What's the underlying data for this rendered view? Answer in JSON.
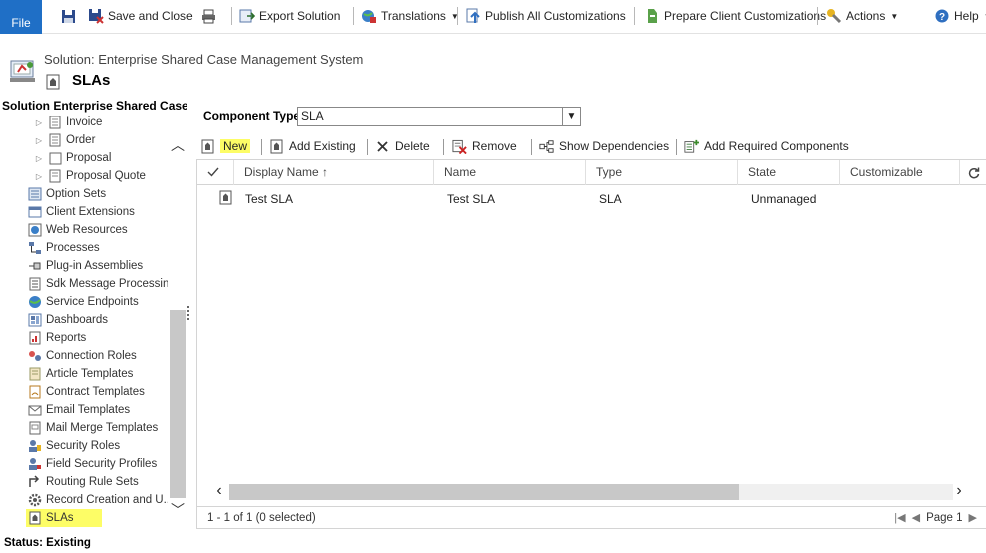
{
  "ribbon": {
    "file": "File",
    "save": "",
    "save_close": "Save and Close",
    "export": "Export Solution",
    "translations": "Translations",
    "publish": "Publish All Customizations",
    "prepare": "Prepare Client Customizations",
    "actions": "Actions",
    "help": "Help"
  },
  "header": {
    "solution": "Solution: Enterprise Shared Case Management System",
    "title": "SLAs"
  },
  "nav": {
    "title": "Solution Enterprise Shared Case...",
    "items": [
      {
        "label": "Invoice",
        "icon": "document-icon",
        "child": true
      },
      {
        "label": "Order",
        "icon": "order-icon",
        "child": true
      },
      {
        "label": "Proposal",
        "icon": "proposal-icon",
        "child": true
      },
      {
        "label": "Proposal Quote",
        "icon": "quote-icon",
        "child": true
      },
      {
        "label": "Option Sets",
        "icon": "option-sets-icon"
      },
      {
        "label": "Client Extensions",
        "icon": "client-extensions-icon"
      },
      {
        "label": "Web Resources",
        "icon": "web-resources-icon"
      },
      {
        "label": "Processes",
        "icon": "processes-icon"
      },
      {
        "label": "Plug-in Assemblies",
        "icon": "plugin-icon"
      },
      {
        "label": "Sdk Message Processing...",
        "icon": "sdk-icon"
      },
      {
        "label": "Service Endpoints",
        "icon": "globe-icon"
      },
      {
        "label": "Dashboards",
        "icon": "dashboard-icon"
      },
      {
        "label": "Reports",
        "icon": "reports-icon"
      },
      {
        "label": "Connection Roles",
        "icon": "connection-icon"
      },
      {
        "label": "Article Templates",
        "icon": "article-icon"
      },
      {
        "label": "Contract Templates",
        "icon": "contract-icon"
      },
      {
        "label": "Email Templates",
        "icon": "email-icon"
      },
      {
        "label": "Mail Merge Templates",
        "icon": "mail-merge-icon"
      },
      {
        "label": "Security Roles",
        "icon": "security-roles-icon"
      },
      {
        "label": "Field Security Profiles",
        "icon": "field-security-icon"
      },
      {
        "label": "Routing Rule Sets",
        "icon": "routing-icon"
      },
      {
        "label": "Record Creation and U...",
        "icon": "gear-icon"
      },
      {
        "label": "SLAs",
        "icon": "sla-icon",
        "selected": true
      }
    ]
  },
  "component_type": {
    "label": "Component Type",
    "value": "SLA"
  },
  "toolbar": {
    "new": "New",
    "add_existing": "Add Existing",
    "delete": "Delete",
    "remove": "Remove",
    "show_dependencies": "Show Dependencies",
    "add_required": "Add Required Components"
  },
  "grid": {
    "columns": [
      "Display Name ↑",
      "Name",
      "Type",
      "State",
      "Customizable"
    ],
    "rows": [
      {
        "display_name": "Test SLA",
        "name": "Test SLA",
        "type": "SLA",
        "state": "Unmanaged",
        "customizable": ""
      }
    ],
    "count": "1 - 1 of 1 (0 selected)",
    "page": "Page 1"
  },
  "status": "Status: Existing",
  "colors": {
    "accent": "#1f6fc6",
    "highlight": "#fdfd66"
  }
}
